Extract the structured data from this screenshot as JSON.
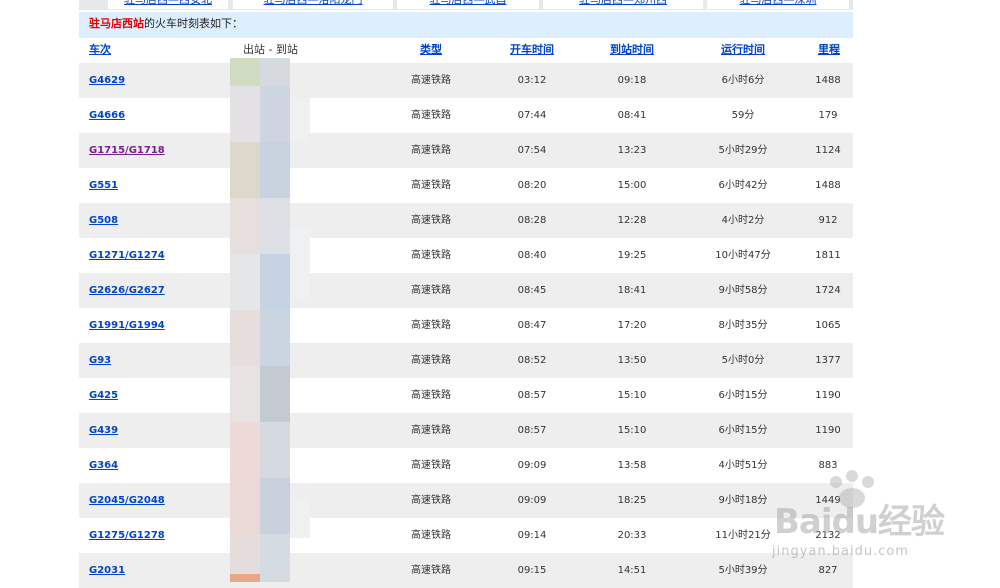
{
  "top_nav": [
    "驻马店西—西安北",
    "驻马店西—洛阳龙门",
    "驻马店西—武昌",
    "驻马店西—郑州西",
    "驻马店西—深圳"
  ],
  "header": {
    "station": "驻马店西站",
    "suffix": "的火车时刻表如下："
  },
  "columns": {
    "train": "车次",
    "route": "出站 - 到站",
    "type": "类型",
    "depart": "开车时间",
    "arrive": "到站时间",
    "duration": "运行时间",
    "distance": "里程"
  },
  "rows": [
    {
      "train": "G4629",
      "type": "高速铁路",
      "depart": "03:12",
      "arrive": "09:18",
      "duration": "6小时6分",
      "distance": "1488"
    },
    {
      "train": "G4666",
      "type": "高速铁路",
      "depart": "07:44",
      "arrive": "08:41",
      "duration": "59分",
      "distance": "179"
    },
    {
      "train": "G1715/G1718",
      "type": "高速铁路",
      "depart": "07:54",
      "arrive": "13:23",
      "duration": "5小时29分",
      "distance": "1124"
    },
    {
      "train": "G551",
      "type": "高速铁路",
      "depart": "08:20",
      "arrive": "15:00",
      "duration": "6小时42分",
      "distance": "1488"
    },
    {
      "train": "G508",
      "type": "高速铁路",
      "depart": "08:28",
      "arrive": "12:28",
      "duration": "4小时2分",
      "distance": "912"
    },
    {
      "train": "G1271/G1274",
      "type": "高速铁路",
      "depart": "08:40",
      "arrive": "19:25",
      "duration": "10小时47分",
      "distance": "1811"
    },
    {
      "train": "G2626/G2627",
      "type": "高速铁路",
      "depart": "08:45",
      "arrive": "18:41",
      "duration": "9小时58分",
      "distance": "1724"
    },
    {
      "train": "G1991/G1994",
      "type": "高速铁路",
      "depart": "08:47",
      "arrive": "17:20",
      "duration": "8小时35分",
      "distance": "1065"
    },
    {
      "train": "G93",
      "type": "高速铁路",
      "depart": "08:52",
      "arrive": "13:50",
      "duration": "5小时0分",
      "distance": "1377"
    },
    {
      "train": "G425",
      "type": "高速铁路",
      "depart": "08:57",
      "arrive": "15:10",
      "duration": "6小时15分",
      "distance": "1190"
    },
    {
      "train": "G439",
      "type": "高速铁路",
      "depart": "08:57",
      "arrive": "15:10",
      "duration": "6小时15分",
      "distance": "1190"
    },
    {
      "train": "G364",
      "type": "高速铁路",
      "depart": "09:09",
      "arrive": "13:58",
      "duration": "4小时51分",
      "distance": "883"
    },
    {
      "train": "G2045/G2048",
      "type": "高速铁路",
      "depart": "09:09",
      "arrive": "18:25",
      "duration": "9小时18分",
      "distance": "1449"
    },
    {
      "train": "G1275/G1278",
      "type": "高速铁路",
      "depart": "09:14",
      "arrive": "20:33",
      "duration": "11小时21分",
      "distance": "2132"
    },
    {
      "train": "G2031",
      "type": "高速铁路",
      "depart": "09:15",
      "arrive": "14:51",
      "duration": "5小时39分",
      "distance": "827"
    }
  ],
  "watermark": {
    "brand": "Baidu经验",
    "url": "jingyan.baidu.com"
  },
  "colors": {
    "link": "#0044cc",
    "visited": "#7a1f8f",
    "station": "#e60000",
    "header_bg": "#ddeeff",
    "row_alt": "#eeeeee"
  }
}
